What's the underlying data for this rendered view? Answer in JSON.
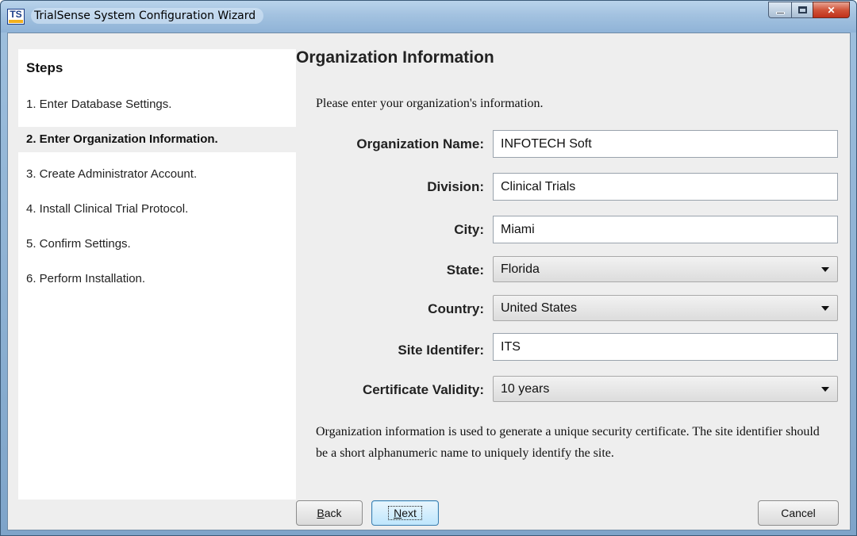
{
  "window": {
    "title": "TrialSense System Configuration Wizard",
    "icon_text": "TS"
  },
  "sidebar": {
    "title": "Steps",
    "items": [
      {
        "label": "1. Enter Database Settings."
      },
      {
        "label": "2. Enter Organization Information.",
        "current": true
      },
      {
        "label": "3. Create Administrator Account."
      },
      {
        "label": "4. Install Clinical Trial Protocol."
      },
      {
        "label": "5. Confirm Settings."
      },
      {
        "label": "6. Perform Installation."
      }
    ]
  },
  "main": {
    "heading": "Organization Information",
    "intro": "Please enter your organization's information.",
    "fields": {
      "organization_name": {
        "label": "Organization Name:",
        "value": "INFOTECH Soft"
      },
      "division": {
        "label": "Division:",
        "value": "Clinical Trials"
      },
      "city": {
        "label": "City:",
        "value": "Miami"
      },
      "state": {
        "label": "State:",
        "value": "Florida"
      },
      "country": {
        "label": "Country:",
        "value": "United States"
      },
      "site_identifier": {
        "label": "Site Identifer:",
        "value": "ITS"
      },
      "certificate_validity": {
        "label": "Certificate Validity:",
        "value": "10 years"
      }
    },
    "note": "Organization information is used to generate a unique security certificate. The site identifier should be a short alphanumeric name to uniquely identify the site."
  },
  "buttons": {
    "back_mnemonic": "B",
    "back_rest": "ack",
    "next_mnemonic": "N",
    "next_rest": "ext",
    "cancel": "Cancel"
  },
  "colors": {
    "titlebar": "#a3c2e0",
    "close_button": "#c0301a",
    "panel_background": "#eeeeee",
    "sidebar_background": "#ffffff"
  }
}
